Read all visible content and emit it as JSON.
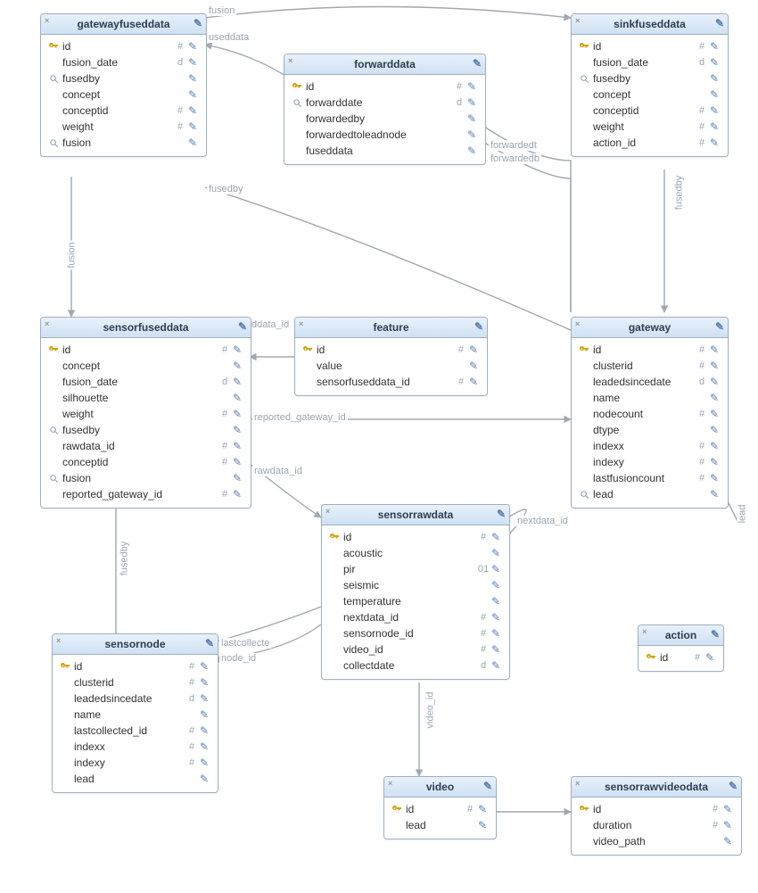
{
  "tables": {
    "gatewayfuseddata": {
      "title": "gatewayfuseddata",
      "cols": [
        {
          "icon": "key",
          "name": "id",
          "type": "#"
        },
        {
          "icon": "",
          "name": "fusion_date",
          "type": "d"
        },
        {
          "icon": "mag",
          "name": "fusedby",
          "type": ""
        },
        {
          "icon": "",
          "name": "concept",
          "type": ""
        },
        {
          "icon": "",
          "name": "conceptid",
          "type": "#"
        },
        {
          "icon": "",
          "name": "weight",
          "type": "#"
        },
        {
          "icon": "mag",
          "name": "fusion",
          "type": ""
        }
      ]
    },
    "sinkfuseddata": {
      "title": "sinkfuseddata",
      "cols": [
        {
          "icon": "key",
          "name": "id",
          "type": "#"
        },
        {
          "icon": "",
          "name": "fusion_date",
          "type": "d"
        },
        {
          "icon": "mag",
          "name": "fusedby",
          "type": ""
        },
        {
          "icon": "",
          "name": "concept",
          "type": ""
        },
        {
          "icon": "",
          "name": "conceptid",
          "type": "#"
        },
        {
          "icon": "",
          "name": "weight",
          "type": "#"
        },
        {
          "icon": "",
          "name": "action_id",
          "type": "#"
        }
      ]
    },
    "forwarddata": {
      "title": "forwarddata",
      "cols": [
        {
          "icon": "key",
          "name": "id",
          "type": "#"
        },
        {
          "icon": "mag",
          "name": "forwarddate",
          "type": "d"
        },
        {
          "icon": "",
          "name": "forwardedby",
          "type": ""
        },
        {
          "icon": "",
          "name": "forwardedtoleadnode",
          "type": ""
        },
        {
          "icon": "",
          "name": "fuseddata",
          "type": ""
        }
      ]
    },
    "sensorfuseddata": {
      "title": "sensorfuseddata",
      "cols": [
        {
          "icon": "key",
          "name": "id",
          "type": "#"
        },
        {
          "icon": "",
          "name": "concept",
          "type": ""
        },
        {
          "icon": "",
          "name": "fusion_date",
          "type": "d"
        },
        {
          "icon": "",
          "name": "silhouette",
          "type": ""
        },
        {
          "icon": "",
          "name": "weight",
          "type": "#"
        },
        {
          "icon": "mag",
          "name": "fusedby",
          "type": ""
        },
        {
          "icon": "",
          "name": "rawdata_id",
          "type": "#"
        },
        {
          "icon": "",
          "name": "conceptid",
          "type": "#"
        },
        {
          "icon": "mag",
          "name": "fusion",
          "type": ""
        },
        {
          "icon": "",
          "name": "reported_gateway_id",
          "type": "#"
        }
      ]
    },
    "feature": {
      "title": "feature",
      "cols": [
        {
          "icon": "key",
          "name": "id",
          "type": "#"
        },
        {
          "icon": "",
          "name": "value",
          "type": ""
        },
        {
          "icon": "",
          "name": "sensorfuseddata_id",
          "type": "#"
        }
      ]
    },
    "gateway": {
      "title": "gateway",
      "cols": [
        {
          "icon": "key",
          "name": "id",
          "type": "#"
        },
        {
          "icon": "",
          "name": "clusterid",
          "type": "#"
        },
        {
          "icon": "",
          "name": "leadedsincedate",
          "type": "d"
        },
        {
          "icon": "",
          "name": "name",
          "type": ""
        },
        {
          "icon": "",
          "name": "nodecount",
          "type": "#"
        },
        {
          "icon": "",
          "name": "dtype",
          "type": ""
        },
        {
          "icon": "",
          "name": "indexx",
          "type": "#"
        },
        {
          "icon": "",
          "name": "indexy",
          "type": "#"
        },
        {
          "icon": "",
          "name": "lastfusioncount",
          "type": "#"
        },
        {
          "icon": "mag",
          "name": "lead",
          "type": ""
        }
      ]
    },
    "sensorrawdata": {
      "title": "sensorrawdata",
      "cols": [
        {
          "icon": "key",
          "name": "id",
          "type": "#"
        },
        {
          "icon": "",
          "name": "acoustic",
          "type": ""
        },
        {
          "icon": "",
          "name": "pir",
          "type": "01"
        },
        {
          "icon": "",
          "name": "seismic",
          "type": ""
        },
        {
          "icon": "",
          "name": "temperature",
          "type": ""
        },
        {
          "icon": "",
          "name": "nextdata_id",
          "type": "#"
        },
        {
          "icon": "",
          "name": "sensornode_id",
          "type": "#"
        },
        {
          "icon": "",
          "name": "video_id",
          "type": "#"
        },
        {
          "icon": "",
          "name": "collectdate",
          "type": "d"
        }
      ]
    },
    "sensornode": {
      "title": "sensornode",
      "cols": [
        {
          "icon": "key",
          "name": "id",
          "type": "#"
        },
        {
          "icon": "",
          "name": "clusterid",
          "type": "#"
        },
        {
          "icon": "",
          "name": "leadedsincedate",
          "type": "d"
        },
        {
          "icon": "",
          "name": "name",
          "type": ""
        },
        {
          "icon": "",
          "name": "lastcollected_id",
          "type": "#"
        },
        {
          "icon": "",
          "name": "indexx",
          "type": "#"
        },
        {
          "icon": "",
          "name": "indexy",
          "type": "#"
        },
        {
          "icon": "",
          "name": "lead",
          "type": ""
        }
      ]
    },
    "video": {
      "title": "video",
      "cols": [
        {
          "icon": "key",
          "name": "id",
          "type": "#"
        },
        {
          "icon": "",
          "name": "lead",
          "type": ""
        }
      ]
    },
    "action": {
      "title": "action",
      "cols": [
        {
          "icon": "key",
          "name": "id",
          "type": "#"
        }
      ]
    },
    "sensorrawvideodata": {
      "title": "sensorrawvideodata",
      "cols": [
        {
          "icon": "key",
          "name": "id",
          "type": "#"
        },
        {
          "icon": "",
          "name": "duration",
          "type": "#"
        },
        {
          "icon": "",
          "name": "video_path",
          "type": ""
        }
      ]
    }
  },
  "labels": {
    "fusion": "fusion",
    "useddata": "useddata",
    "fusedby": "fusedby",
    "forwardedt": "forwardedt",
    "forwardedb": "forwardedb",
    "ddata_id": "ddata_id",
    "reported_gateway_id": "reported_gateway_id",
    "rawdata_id": "rawdata_id",
    "nextdata_id": "nextdata_id",
    "node_id": "node_id",
    "lastcollecte": "lastcollecte",
    "video_id": "video_id",
    "lead": "lead"
  }
}
